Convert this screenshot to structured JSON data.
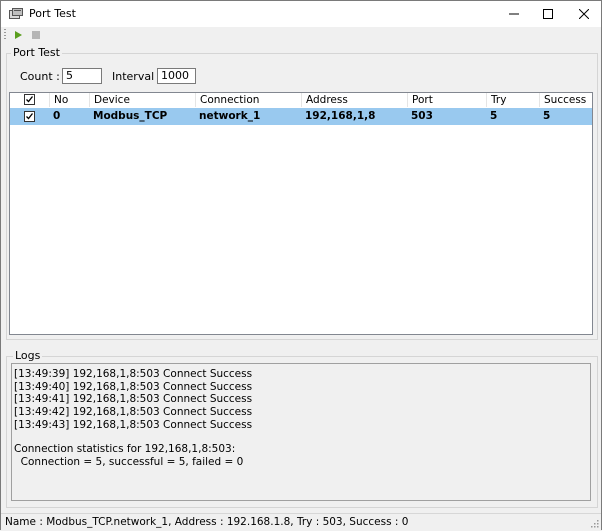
{
  "window": {
    "title": "Port Test"
  },
  "toolbar": {
    "play_icon": "play-icon",
    "stop_icon": "stop-icon"
  },
  "port_test": {
    "group_label": "Port Test",
    "count_label": "Count :",
    "count_value": "5",
    "interval_label": "Interval :",
    "interval_value": "1000"
  },
  "table": {
    "columns": [
      "No",
      "Device",
      "Connection",
      "Address",
      "Port",
      "Try",
      "Success"
    ],
    "header_checked": true,
    "rows": [
      {
        "checked": true,
        "no": "0",
        "device": "Modbus_TCP",
        "connection": "network_1",
        "address": "192,168,1,8",
        "port": "503",
        "try": "5",
        "success": "5"
      }
    ],
    "selected_row_color": "#99c9ef"
  },
  "logs": {
    "group_label": "Logs",
    "lines": [
      "[13:49:39] 192,168,1,8:503 Connect Success",
      "[13:49:40] 192,168,1,8:503 Connect Success",
      "[13:49:41] 192,168,1,8:503 Connect Success",
      "[13:49:42] 192,168,1,8:503 Connect Success",
      "[13:49:43] 192,168,1,8:503 Connect Success",
      "",
      "Connection statistics for 192,168,1,8:503:",
      "  Connection = 5, successful = 5, failed = 0"
    ]
  },
  "status": {
    "text": "Name : Modbus_TCP.network_1, Address : 192.168.1.8, Try : 503, Success : 0"
  }
}
